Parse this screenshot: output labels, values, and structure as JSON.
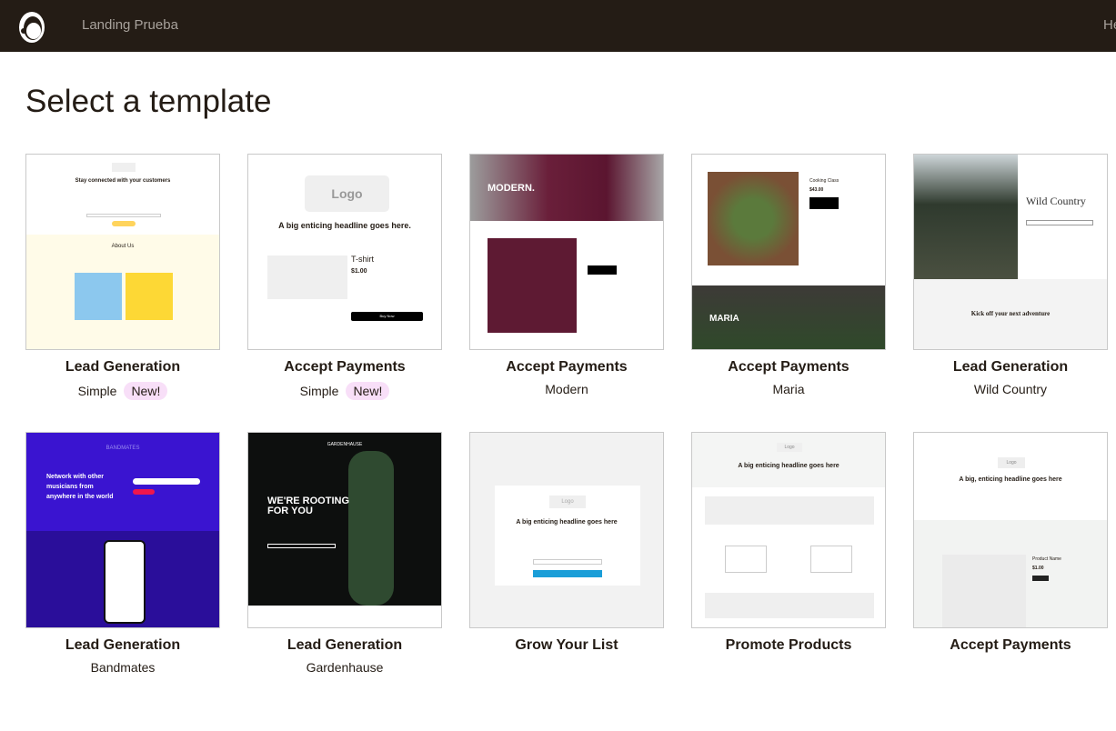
{
  "header": {
    "app_name": "Landing Prueba",
    "right_link": "He",
    "logo": "freddie-logo-icon"
  },
  "page_title": "Select a template",
  "templates": [
    {
      "title": "Lead Generation",
      "subtitle": "Simple",
      "badge": "New!",
      "preview": {
        "headline": "Stay connected with your customers",
        "section": "About Us"
      }
    },
    {
      "title": "Accept Payments",
      "subtitle": "Simple",
      "badge": "New!",
      "preview": {
        "logo": "Logo",
        "headline": "A big enticing headline goes here.",
        "product": "T-shirt",
        "price": "$1.00",
        "button": "Buy Now"
      }
    },
    {
      "title": "Accept Payments",
      "subtitle": "Modern",
      "preview": {
        "headline": "MODERN."
      }
    },
    {
      "title": "Accept Payments",
      "subtitle": "Maria",
      "preview": {
        "product": "Cooking Class",
        "price": "$43.00",
        "headline": "MARIA"
      }
    },
    {
      "title": "Lead Generation",
      "subtitle": "Wild Country",
      "preview": {
        "headline": "Wild Country",
        "tagline": "Kick off your next adventure"
      }
    },
    {
      "title": "Lead Generation",
      "subtitle": "Bandmates",
      "preview": {
        "brand": "BANDMATES",
        "headline": "Network with other musicians from anywhere in the world"
      }
    },
    {
      "title": "Lead Generation",
      "subtitle": "Gardenhause",
      "preview": {
        "brand": "GARDENHAUSE",
        "headline": "WE'RE ROOTING FOR YOU"
      }
    },
    {
      "title": "Grow Your List",
      "subtitle": "",
      "preview": {
        "logo": "Logo",
        "headline": "A big enticing headline goes here"
      }
    },
    {
      "title": "Promote Products",
      "subtitle": "",
      "preview": {
        "logo": "Logo",
        "headline": "A big enticing headline goes here"
      }
    },
    {
      "title": "Accept Payments",
      "subtitle": "",
      "preview": {
        "logo": "Logo",
        "headline": "A big, enticing headline goes here",
        "product": "Product Name",
        "price": "$1.00"
      }
    }
  ]
}
